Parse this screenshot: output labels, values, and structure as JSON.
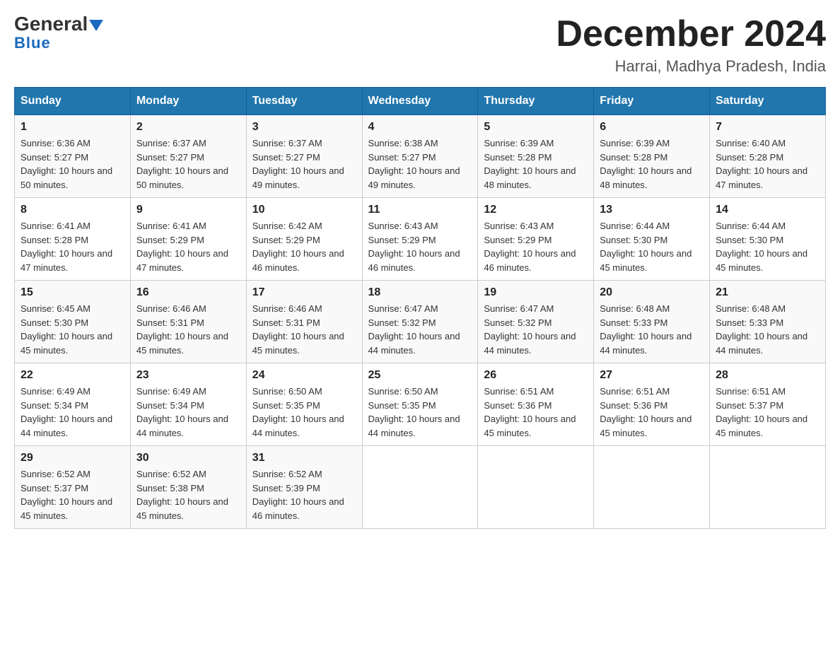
{
  "header": {
    "logo_general": "General",
    "logo_blue": "Blue",
    "title": "December 2024",
    "subtitle": "Harrai, Madhya Pradesh, India"
  },
  "weekdays": [
    "Sunday",
    "Monday",
    "Tuesday",
    "Wednesday",
    "Thursday",
    "Friday",
    "Saturday"
  ],
  "weeks": [
    [
      {
        "day": "1",
        "sunrise": "6:36 AM",
        "sunset": "5:27 PM",
        "daylight": "10 hours and 50 minutes."
      },
      {
        "day": "2",
        "sunrise": "6:37 AM",
        "sunset": "5:27 PM",
        "daylight": "10 hours and 50 minutes."
      },
      {
        "day": "3",
        "sunrise": "6:37 AM",
        "sunset": "5:27 PM",
        "daylight": "10 hours and 49 minutes."
      },
      {
        "day": "4",
        "sunrise": "6:38 AM",
        "sunset": "5:27 PM",
        "daylight": "10 hours and 49 minutes."
      },
      {
        "day": "5",
        "sunrise": "6:39 AM",
        "sunset": "5:28 PM",
        "daylight": "10 hours and 48 minutes."
      },
      {
        "day": "6",
        "sunrise": "6:39 AM",
        "sunset": "5:28 PM",
        "daylight": "10 hours and 48 minutes."
      },
      {
        "day": "7",
        "sunrise": "6:40 AM",
        "sunset": "5:28 PM",
        "daylight": "10 hours and 47 minutes."
      }
    ],
    [
      {
        "day": "8",
        "sunrise": "6:41 AM",
        "sunset": "5:28 PM",
        "daylight": "10 hours and 47 minutes."
      },
      {
        "day": "9",
        "sunrise": "6:41 AM",
        "sunset": "5:29 PM",
        "daylight": "10 hours and 47 minutes."
      },
      {
        "day": "10",
        "sunrise": "6:42 AM",
        "sunset": "5:29 PM",
        "daylight": "10 hours and 46 minutes."
      },
      {
        "day": "11",
        "sunrise": "6:43 AM",
        "sunset": "5:29 PM",
        "daylight": "10 hours and 46 minutes."
      },
      {
        "day": "12",
        "sunrise": "6:43 AM",
        "sunset": "5:29 PM",
        "daylight": "10 hours and 46 minutes."
      },
      {
        "day": "13",
        "sunrise": "6:44 AM",
        "sunset": "5:30 PM",
        "daylight": "10 hours and 45 minutes."
      },
      {
        "day": "14",
        "sunrise": "6:44 AM",
        "sunset": "5:30 PM",
        "daylight": "10 hours and 45 minutes."
      }
    ],
    [
      {
        "day": "15",
        "sunrise": "6:45 AM",
        "sunset": "5:30 PM",
        "daylight": "10 hours and 45 minutes."
      },
      {
        "day": "16",
        "sunrise": "6:46 AM",
        "sunset": "5:31 PM",
        "daylight": "10 hours and 45 minutes."
      },
      {
        "day": "17",
        "sunrise": "6:46 AM",
        "sunset": "5:31 PM",
        "daylight": "10 hours and 45 minutes."
      },
      {
        "day": "18",
        "sunrise": "6:47 AM",
        "sunset": "5:32 PM",
        "daylight": "10 hours and 44 minutes."
      },
      {
        "day": "19",
        "sunrise": "6:47 AM",
        "sunset": "5:32 PM",
        "daylight": "10 hours and 44 minutes."
      },
      {
        "day": "20",
        "sunrise": "6:48 AM",
        "sunset": "5:33 PM",
        "daylight": "10 hours and 44 minutes."
      },
      {
        "day": "21",
        "sunrise": "6:48 AM",
        "sunset": "5:33 PM",
        "daylight": "10 hours and 44 minutes."
      }
    ],
    [
      {
        "day": "22",
        "sunrise": "6:49 AM",
        "sunset": "5:34 PM",
        "daylight": "10 hours and 44 minutes."
      },
      {
        "day": "23",
        "sunrise": "6:49 AM",
        "sunset": "5:34 PM",
        "daylight": "10 hours and 44 minutes."
      },
      {
        "day": "24",
        "sunrise": "6:50 AM",
        "sunset": "5:35 PM",
        "daylight": "10 hours and 44 minutes."
      },
      {
        "day": "25",
        "sunrise": "6:50 AM",
        "sunset": "5:35 PM",
        "daylight": "10 hours and 44 minutes."
      },
      {
        "day": "26",
        "sunrise": "6:51 AM",
        "sunset": "5:36 PM",
        "daylight": "10 hours and 45 minutes."
      },
      {
        "day": "27",
        "sunrise": "6:51 AM",
        "sunset": "5:36 PM",
        "daylight": "10 hours and 45 minutes."
      },
      {
        "day": "28",
        "sunrise": "6:51 AM",
        "sunset": "5:37 PM",
        "daylight": "10 hours and 45 minutes."
      }
    ],
    [
      {
        "day": "29",
        "sunrise": "6:52 AM",
        "sunset": "5:37 PM",
        "daylight": "10 hours and 45 minutes."
      },
      {
        "day": "30",
        "sunrise": "6:52 AM",
        "sunset": "5:38 PM",
        "daylight": "10 hours and 45 minutes."
      },
      {
        "day": "31",
        "sunrise": "6:52 AM",
        "sunset": "5:39 PM",
        "daylight": "10 hours and 46 minutes."
      },
      null,
      null,
      null,
      null
    ]
  ]
}
